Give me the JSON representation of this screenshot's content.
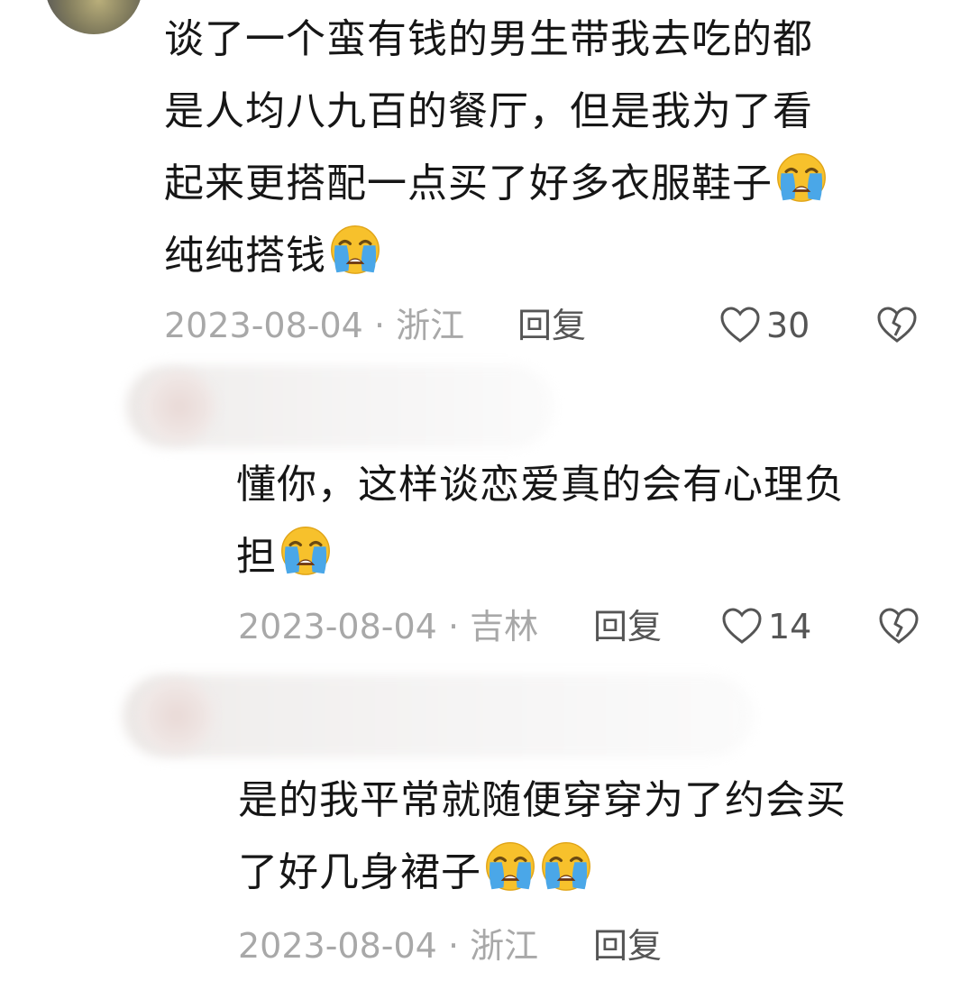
{
  "comments": [
    {
      "text_lines": [
        "谈了一个蛮有钱的男生带我去吃的都",
        "是人均八九百的餐厅，但是我为了看",
        "起来更搭配一点买了好多衣服鞋子",
        "纯纯搭钱"
      ],
      "emoji_lines": [
        2,
        3
      ],
      "date": "2023-08-04",
      "dot": "·",
      "location": "浙江",
      "reply_label": "回复",
      "likes": "30"
    },
    {
      "text_lines": [
        "懂你，这样谈恋爱真的会有心理负",
        "担"
      ],
      "emoji_lines": [
        1
      ],
      "date": "2023-08-04",
      "dot": "·",
      "location": "吉林",
      "reply_label": "回复",
      "likes": "14"
    },
    {
      "text_lines": [
        "是的我平常就随便穿穿为了约会买",
        "了好几身裙子"
      ],
      "emoji_lines": [
        1
      ],
      "emoji_count_last": 2,
      "date": "2023-08-04",
      "dot": "·",
      "location": "浙江",
      "reply_label": "回复"
    }
  ],
  "icons": {
    "like": "heart-outline-icon",
    "dislike": "broken-heart-icon",
    "emoji": "loudly-crying-face-icon"
  },
  "colors": {
    "text": "#161616",
    "meta": "#a8a8a8",
    "action": "#555555",
    "emoji_face": "#f7c12c",
    "emoji_tears": "#4aa7e8"
  }
}
